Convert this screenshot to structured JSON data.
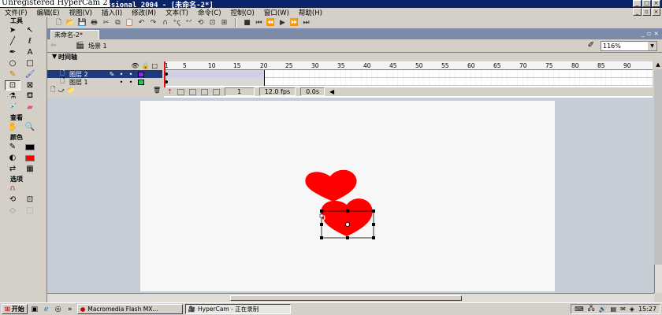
{
  "window": {
    "title": "Macromedia Flash MX Professional 2004 - [未命名-2*]",
    "watermark": "Unregistered HyperCam 2"
  },
  "menu": [
    "文件(F)",
    "编辑(E)",
    "视图(V)",
    "插入(I)",
    "修改(M)",
    "文本(T)",
    "命令(C)",
    "控制(O)",
    "窗口(W)",
    "帮助(H)"
  ],
  "tools": {
    "title": "工具",
    "view_title": "查看",
    "colors_title": "颜色",
    "options_title": "选项",
    "icons": [
      "arrow-icon",
      "subselect-icon",
      "line-icon",
      "lasso-icon",
      "pen-icon",
      "text-icon",
      "oval-icon",
      "rect-icon",
      "pencil-icon",
      "brush-icon",
      "free-transform-icon",
      "fill-transform-icon",
      "ink-bottle-icon",
      "paint-bucket-icon",
      "eyedropper-icon",
      "eraser-icon"
    ]
  },
  "doc": {
    "tab": "未命名-2*",
    "scene": "场景 1",
    "zoom": "116%"
  },
  "timeline": {
    "label": "时间轴",
    "layers": [
      {
        "name": "图层 2",
        "active": true,
        "color": "#8a2be2"
      },
      {
        "name": "图层 1",
        "active": false,
        "color": "#22c55e"
      }
    ],
    "ticks": [
      "1",
      "5",
      "10",
      "15",
      "20",
      "25",
      "30",
      "35",
      "40",
      "45",
      "50",
      "55",
      "60",
      "65",
      "70",
      "75",
      "80",
      "85",
      "90"
    ],
    "current_frame": "1",
    "fps": "12.0 fps",
    "elapsed": "0.0s"
  },
  "colors": {
    "stroke": "#000000",
    "fill": "#ff0000",
    "heart": "#ff0000"
  },
  "taskbar": {
    "start": "开始",
    "tasks": [
      "Macromedia Flash MX...",
      "HyperCam - 正在录制"
    ],
    "clock": "15:27"
  }
}
